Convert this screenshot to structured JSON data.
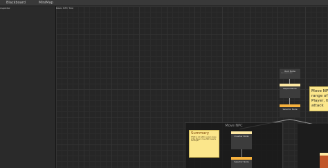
{
  "toolbar": {
    "blackboard_label": "Blackboard",
    "minimap_label": "MiniMap"
  },
  "inspector": {
    "label": "nspector"
  },
  "graph": {
    "title": "Basic NPC Tree",
    "nodes": {
      "root": {
        "title": "Root Node",
        "desc": "Lorem ipsum dolor"
      },
      "repeat": {
        "title": "Repeat Node"
      },
      "selector_top": {
        "title": "Selector Node"
      },
      "inverter": {
        "title": "Inverter Node"
      },
      "selector_group": {
        "title": "Selector Node"
      }
    },
    "group": {
      "title": "Move NPC"
    },
    "sticky_summary": {
      "title": "Summary",
      "text": "If NPC is not within a given range\nof the Player, move NPC towards\nthe Player"
    },
    "sticky_right": {
      "text": "Move NPC\nrange of th\nPlayer, th\nattack"
    }
  },
  "colors": {
    "node_header_light": "#fde8a3",
    "node_header_orange": "#f6b13d",
    "node_header_dark": "#2b2b2b",
    "sticky_bg": "#fbe68b"
  }
}
